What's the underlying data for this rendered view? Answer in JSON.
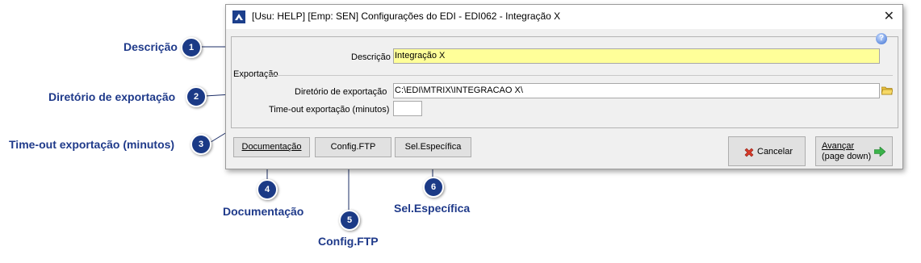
{
  "window": {
    "title": "[Usu: HELP] [Emp: SEN] Configurações do EDI - EDI062 - Integração X",
    "close_glyph": "✕",
    "help_glyph": "?"
  },
  "form": {
    "descricao_label": "Descrição",
    "descricao_value": "Integração X",
    "exportacao_group": "Exportação",
    "diretorio_label": "Diretório  de exportação",
    "diretorio_value": "C:\\EDI\\MTRIX\\INTEGRACAO X\\",
    "timeout_label": "Time-out exportação (minutos)",
    "timeout_value": ""
  },
  "buttons": {
    "documentacao": "Documentação",
    "config_ftp": "Config.FTP",
    "sel_especifica": "Sel.Específica",
    "cancelar": "Cancelar",
    "avancar_line1": "Avançar",
    "avancar_line2": "(page down)"
  },
  "callouts": [
    {
      "number": "1",
      "label": "Descrição"
    },
    {
      "number": "2",
      "label": "Diretório de exportação"
    },
    {
      "number": "3",
      "label": "Time-out exportação (minutos)"
    },
    {
      "number": "4",
      "label": "Documentação"
    },
    {
      "number": "5",
      "label": "Config.FTP"
    },
    {
      "number": "6",
      "label": "Sel.Específica"
    }
  ],
  "colors": {
    "descricao_field_bg": "#ffff99",
    "callout_badge": "#1b3a86",
    "callout_text": "#1f3a8a",
    "folder_icon": "#e8c040",
    "cancel_icon": "#d83a2a",
    "advance_icon": "#3bb24a"
  },
  "icons": [
    "app-icon",
    "close-icon",
    "help-icon",
    "folder-icon",
    "cancel-icon",
    "arrow-right-icon"
  ]
}
